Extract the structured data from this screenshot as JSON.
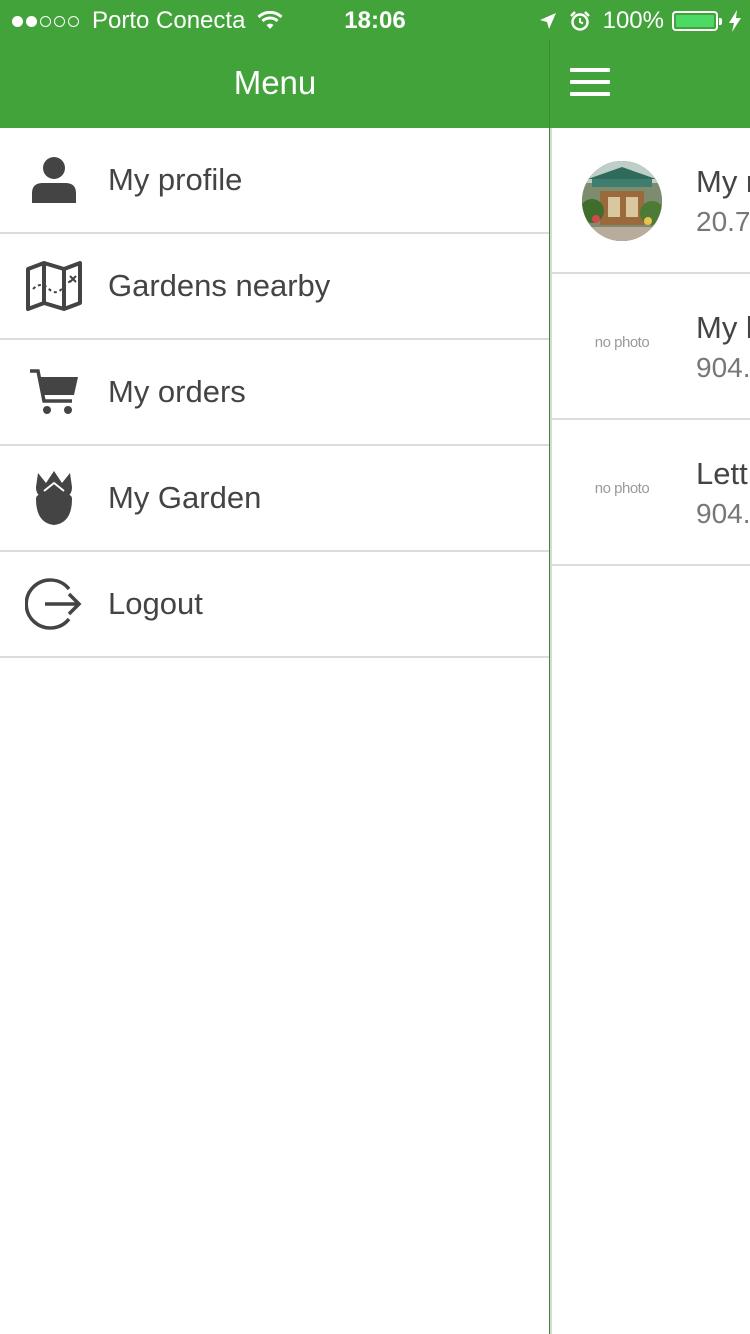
{
  "status_bar": {
    "carrier": "Porto Conecta",
    "time": "18:06",
    "battery": "100%",
    "battery_level": 1.0
  },
  "header": {
    "title": "Menu"
  },
  "drawer": {
    "items": [
      {
        "label": "My profile",
        "icon": "person-icon"
      },
      {
        "label": "Gardens nearby",
        "icon": "map-icon"
      },
      {
        "label": "My orders",
        "icon": "cart-icon"
      },
      {
        "label": "My Garden",
        "icon": "flower-icon"
      },
      {
        "label": "Logout",
        "icon": "logout-icon"
      }
    ]
  },
  "content": {
    "rows": [
      {
        "title": "My r",
        "sub": "20.7",
        "thumb": "photo"
      },
      {
        "title": "My l",
        "sub": "904.",
        "thumb": "no photo"
      },
      {
        "title": "Lett",
        "sub": "904.",
        "thumb": "no photo"
      }
    ]
  },
  "colors": {
    "header_green": "#43a33b",
    "text": "#444444",
    "divider": "#dcdcdc"
  }
}
